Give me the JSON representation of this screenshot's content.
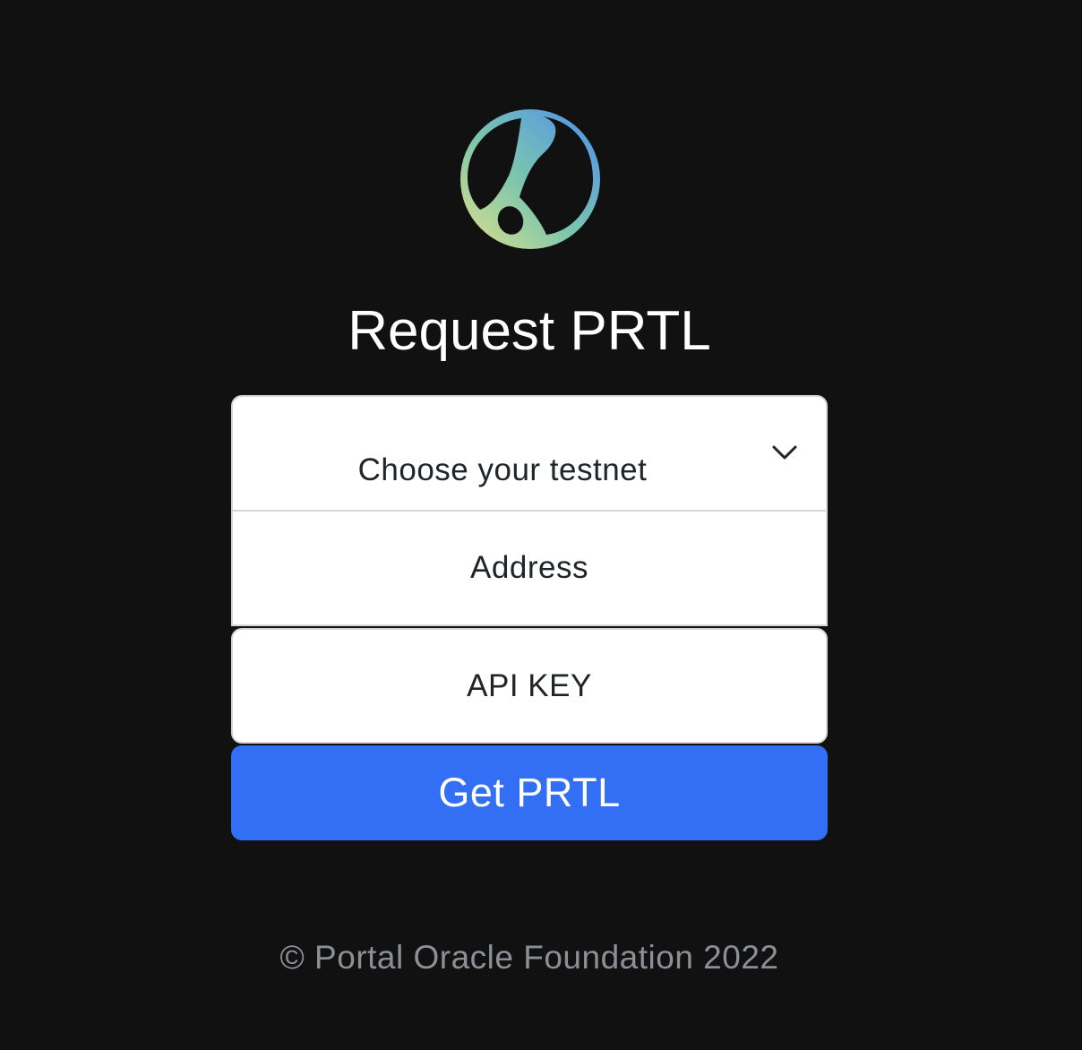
{
  "logo": {
    "icon": "portal-globe-logo",
    "gradient": [
      "#c9dc8e",
      "#7ec9b0",
      "#4f95e8"
    ]
  },
  "heading": {
    "title": "Request PRTL"
  },
  "form": {
    "testnet_select": {
      "selected_label": "Choose your testnet",
      "icon": "chevron-down-icon"
    },
    "address_input": {
      "placeholder": "Address",
      "value": ""
    },
    "api_key_input": {
      "placeholder": "API KEY",
      "value": ""
    },
    "submit_label": "Get PRTL"
  },
  "footer": {
    "copyright": "© Portal Oracle Foundation 2022"
  },
  "colors": {
    "background": "#111111",
    "button": "#336ff4",
    "footer_text": "#8c9096"
  }
}
